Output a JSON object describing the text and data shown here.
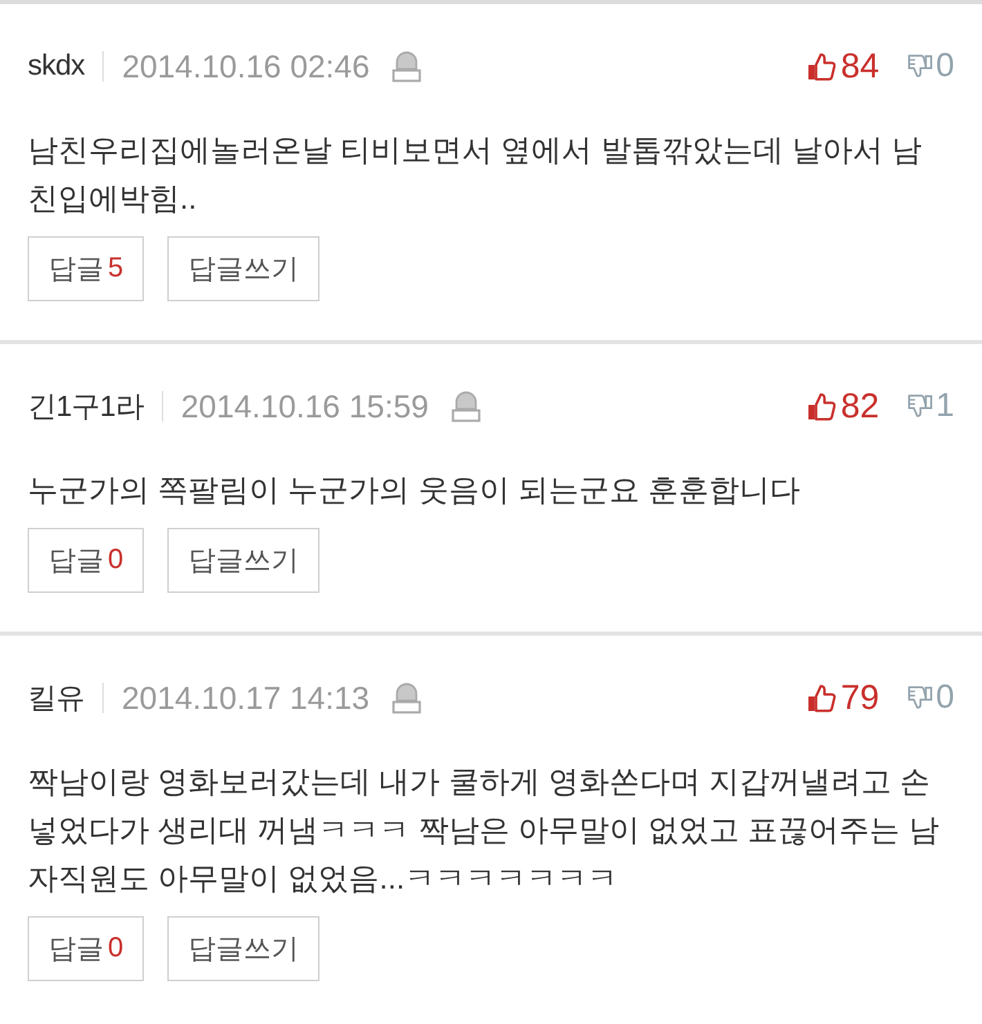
{
  "comments": [
    {
      "author": "skdx",
      "date": "2014.10.16 02:46",
      "likes": "84",
      "dislikes": "0",
      "text": "남친우리집에놀러온날 티비보면서 옆에서 발톱깎았는데 날아서 남친입에박힘..",
      "reply_label": "답글",
      "reply_count": "5",
      "write_reply_label": "답글쓰기"
    },
    {
      "author": "긴1구1라",
      "date": "2014.10.16 15:59",
      "likes": "82",
      "dislikes": "1",
      "text": "누군가의 쪽팔림이 누군가의 웃음이 되는군요 훈훈합니다",
      "reply_label": "답글",
      "reply_count": "0",
      "write_reply_label": "답글쓰기"
    },
    {
      "author": "킬유",
      "date": "2014.10.17 14:13",
      "likes": "79",
      "dislikes": "0",
      "text": "짝남이랑 영화보러갔는데 내가 쿨하게 영화쏜다며 지갑꺼낼려고 손넣었다가 생리대 꺼냄ㅋㅋㅋ 짝남은 아무말이 없었고 표끊어주는 남자직원도 아무말이 없었음...ㅋㅋㅋㅋㅋㅋㅋ",
      "reply_label": "답글",
      "reply_count": "0",
      "write_reply_label": "답글쓰기"
    }
  ]
}
